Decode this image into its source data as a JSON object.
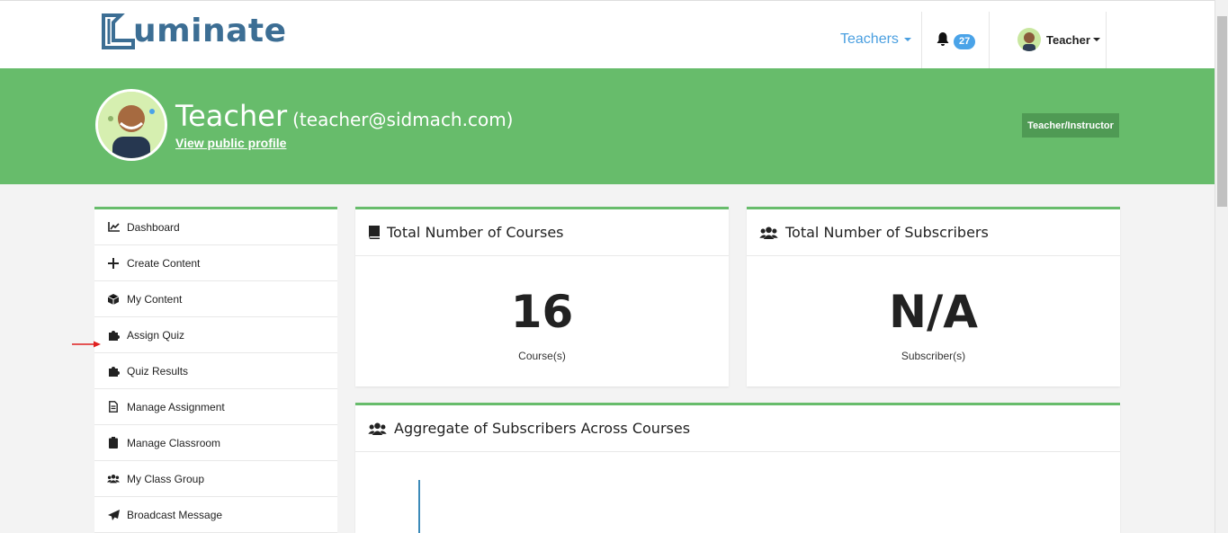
{
  "brand": {
    "logo_text": "uminate"
  },
  "nav": {
    "teachers_label": "Teachers",
    "notification_count": "27",
    "user_label": "Teacher"
  },
  "profile": {
    "name": "Teacher",
    "email": "(teacher@sidmach.com)",
    "view_profile_label": "View public profile",
    "role": "Teacher/Instructor"
  },
  "sidebar": {
    "items": [
      {
        "label": "Dashboard",
        "icon": "chart-line-icon"
      },
      {
        "label": "Create Content",
        "icon": "plus-icon"
      },
      {
        "label": "My Content",
        "icon": "cube-icon"
      },
      {
        "label": "Assign Quiz",
        "icon": "puzzle-icon"
      },
      {
        "label": "Quiz Results",
        "icon": "puzzle-icon"
      },
      {
        "label": "Manage Assignment",
        "icon": "file-icon"
      },
      {
        "label": "Manage Classroom",
        "icon": "clipboard-icon"
      },
      {
        "label": "My Class Group",
        "icon": "users-icon"
      },
      {
        "label": "Broadcast Message",
        "icon": "paper-plane-icon"
      }
    ]
  },
  "cards": {
    "courses": {
      "title": "Total Number of Courses",
      "value": "16",
      "unit": "Course(s)"
    },
    "subscribers": {
      "title": "Total Number of Subscribers",
      "value": "N/A",
      "unit": "Subscriber(s)"
    },
    "aggregate": {
      "title": "Aggregate of Subscribers Across Courses"
    }
  },
  "colors": {
    "accent_green": "#67bc6b",
    "brand_blue": "#3c6e94",
    "link_blue": "#4a9fe0",
    "badge_blue": "#4aa3e8",
    "annotation_red": "#e02020"
  }
}
